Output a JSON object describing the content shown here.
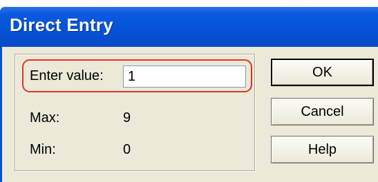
{
  "window": {
    "title": "Direct Entry"
  },
  "form": {
    "entry_label": "Enter value:",
    "entry_value": "1",
    "max_label": "Max:",
    "max_value": "9",
    "min_label": "Min:",
    "min_value": "0"
  },
  "buttons": {
    "ok": "OK",
    "cancel": "Cancel",
    "help": "Help"
  },
  "colors": {
    "titlebar": "#0452d6",
    "dialog_face": "#ece9d8",
    "highlight": "#e0342a"
  }
}
